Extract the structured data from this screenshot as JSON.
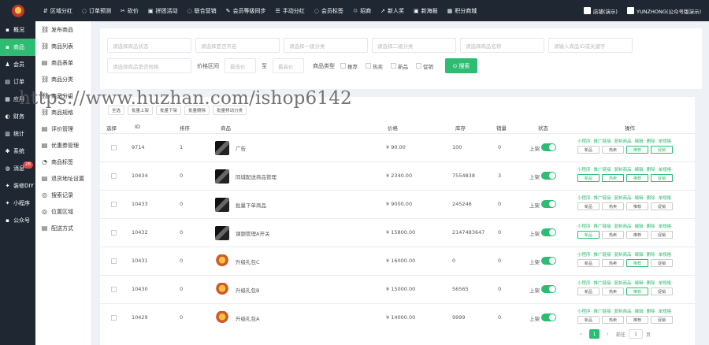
{
  "topnav": [
    {
      "icon": "group-icon",
      "glyph": "⇵",
      "label": "区域分红"
    },
    {
      "icon": "order-icon",
      "glyph": "◌",
      "label": "订单预测"
    },
    {
      "icon": "bargain-icon",
      "glyph": "✂",
      "label": "砍价"
    },
    {
      "icon": "groupbuy-icon",
      "glyph": "▣",
      "label": "拼团活动"
    },
    {
      "icon": "combo-icon",
      "glyph": "◌",
      "label": "联合营销"
    },
    {
      "icon": "member-icon",
      "glyph": "✎",
      "label": "会员等级同步"
    },
    {
      "icon": "share-icon",
      "glyph": "☰",
      "label": "手动分红"
    },
    {
      "icon": "tag-icon",
      "glyph": "◌",
      "label": "会员标签"
    },
    {
      "icon": "recruit-icon",
      "glyph": "♲",
      "label": "招商"
    },
    {
      "icon": "new-icon",
      "glyph": "➚",
      "label": "新人奖"
    },
    {
      "icon": "poster-icon",
      "glyph": "▣",
      "label": "新海报"
    },
    {
      "icon": "points-icon",
      "glyph": "▦",
      "label": "积分商城"
    }
  ],
  "topright": {
    "shop": "店铺(演示)",
    "user": "YUNZHONG(公众号版演示)"
  },
  "sidebar": [
    {
      "icon": "overview-icon",
      "glyph": "▪",
      "label": "概况",
      "active": false
    },
    {
      "icon": "goods-icon",
      "glyph": "▪",
      "label": "商品",
      "active": true
    },
    {
      "icon": "member-icon",
      "glyph": "♟",
      "label": "会员",
      "active": false
    },
    {
      "icon": "order-icon",
      "glyph": "▤",
      "label": "订单",
      "active": false
    },
    {
      "icon": "app-icon",
      "glyph": "▦",
      "label": "应用",
      "active": false
    },
    {
      "icon": "finance-icon",
      "glyph": "◐",
      "label": "财务",
      "active": false
    },
    {
      "icon": "stats-icon",
      "glyph": "▥",
      "label": "统计",
      "active": false
    },
    {
      "icon": "settings-icon",
      "glyph": "✱",
      "label": "系统",
      "active": false
    },
    {
      "icon": "message-icon",
      "glyph": "◍",
      "label": "消息",
      "active": false,
      "badge": "28"
    },
    {
      "icon": "diy-icon",
      "glyph": "✦",
      "label": "装修DIY",
      "active": false
    },
    {
      "icon": "miniapp-icon",
      "glyph": "✦",
      "label": "小程序",
      "active": false
    },
    {
      "icon": "official-icon",
      "glyph": "▪",
      "label": "公众号",
      "active": false
    }
  ],
  "subside": [
    {
      "icon": "publish-icon",
      "glyph": "⛓",
      "label": "发布商品"
    },
    {
      "icon": "list-icon",
      "glyph": "⛓",
      "label": "商品列表"
    },
    {
      "icon": "form-icon",
      "glyph": "▤",
      "label": "商品表单"
    },
    {
      "icon": "category-icon",
      "glyph": "⛓",
      "label": "商品分类"
    },
    {
      "icon": "group-icon",
      "glyph": "⛓",
      "label": "商品分组"
    },
    {
      "icon": "spec-icon",
      "glyph": "⛓",
      "label": "商品规格"
    },
    {
      "icon": "comment-icon",
      "glyph": "▤",
      "label": "评价管理"
    },
    {
      "icon": "coupon-icon",
      "glyph": "▤",
      "label": "优惠券管理"
    },
    {
      "icon": "hot-icon",
      "glyph": "◔",
      "label": "商品标签"
    },
    {
      "icon": "address-icon",
      "glyph": "▤",
      "label": "退货地址设置"
    },
    {
      "icon": "search-icon",
      "glyph": "◎",
      "label": "搜索记录"
    },
    {
      "icon": "location-icon",
      "glyph": "◎",
      "label": "位置区域"
    },
    {
      "icon": "delivery-icon",
      "glyph": "▤",
      "label": "配送方式"
    }
  ],
  "filters": {
    "row1": [
      "请选择商品状态",
      "请选择是否开启",
      "请选择一级分类",
      "请选择二级分类",
      "请选择商品名称",
      "请输入商品ID或关键字"
    ],
    "row2_select": "请选择商品是否规格",
    "price_label": "价格区间",
    "price_min": "最低价",
    "price_sep": "至",
    "price_max": "最高价",
    "attr_label": "商品类型",
    "checks": [
      "推荐",
      "热卖",
      "新品",
      "促销"
    ],
    "search_label": "搜索"
  },
  "actions": [
    "全选",
    "批量上架",
    "批量下架",
    "批量删除",
    "批量移动分类"
  ],
  "columns": [
    "选择",
    "ID",
    "排序",
    "商品",
    "价格",
    "库存",
    "销量",
    "状态",
    "操作"
  ],
  "op_links": [
    "小程序",
    "推广链接",
    "复制商品",
    "编辑",
    "删除",
    "单规格"
  ],
  "op_buttons": [
    "新品",
    "热卖",
    "推荐",
    "促销"
  ],
  "rows": [
    {
      "id": "9714",
      "sort": "1",
      "name": "广告",
      "price": "¥ 90.00",
      "stock": "100",
      "sales": "0",
      "status": "上架",
      "thumb": "dark",
      "on": [
        false,
        false,
        true,
        true
      ]
    },
    {
      "id": "10434",
      "sort": "0",
      "name": "同城配送商品管理",
      "price": "¥ 2340.00",
      "stock": "7554838",
      "sales": "3",
      "status": "上架",
      "thumb": "dark",
      "on": [
        true,
        true,
        true,
        true
      ]
    },
    {
      "id": "10433",
      "sort": "0",
      "name": "批量下单商品",
      "price": "¥ 9000.00",
      "stock": "245246",
      "sales": "0",
      "status": "上架",
      "thumb": "dark",
      "on": [
        false,
        false,
        false,
        false
      ]
    },
    {
      "id": "10432",
      "sort": "0",
      "name": "课题管理A开关",
      "price": "¥ 15800.00",
      "stock": "2147483647",
      "sales": "0",
      "status": "上架",
      "thumb": "dark",
      "on": [
        true,
        false,
        false,
        false
      ]
    },
    {
      "id": "10431",
      "sort": "0",
      "name": "升级礼包C",
      "price": "¥ 16000.00",
      "stock": "0",
      "sales": "0",
      "status": "上架",
      "thumb": "gold",
      "on": [
        false,
        false,
        true,
        false
      ]
    },
    {
      "id": "10430",
      "sort": "0",
      "name": "升级礼包B",
      "price": "¥ 15000.00",
      "stock": "56565",
      "sales": "0",
      "status": "上架",
      "thumb": "gold",
      "on": [
        false,
        false,
        true,
        false
      ]
    },
    {
      "id": "10429",
      "sort": "0",
      "name": "升级礼包A",
      "price": "¥ 14000.00",
      "stock": "9999",
      "sales": "0",
      "status": "上架",
      "thumb": "gold",
      "on": [
        false,
        false,
        false,
        false
      ]
    }
  ],
  "pager": {
    "prev": "‹",
    "current": "1",
    "next": "›",
    "goto_label": "前往",
    "goto_value": "1",
    "page_unit": "页"
  },
  "watermark": "https://www.huzhan.com/ishop6142",
  "colors": {
    "accent": "#2ebc72",
    "dark": "#1f2733",
    "badge": "#e54545"
  }
}
